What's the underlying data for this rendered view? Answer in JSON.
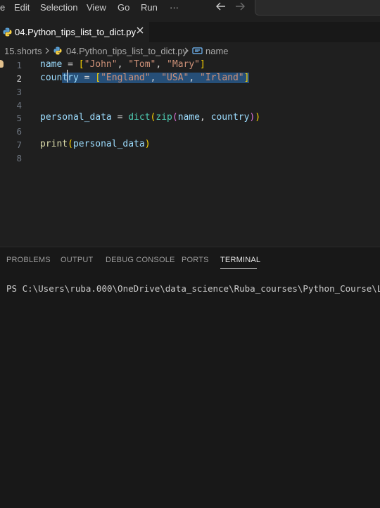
{
  "menu": {
    "partial_first": "e",
    "items": [
      "Edit",
      "Selection",
      "View",
      "Go",
      "Run"
    ],
    "more": "···"
  },
  "nav": {
    "back_icon": "arrow-left-icon",
    "forward_icon": "arrow-right-icon"
  },
  "tab": {
    "label": "04.Python_tips_list_to_dict.py",
    "icon": "python-file-icon",
    "close_icon": "close-icon"
  },
  "breadcrumb": {
    "folder": "15.shorts",
    "file": "04.Python_tips_list_to_dict.py",
    "symbol": "name",
    "symbol_icon": "symbol-variable-icon",
    "separator_icon": "chevron-right-icon"
  },
  "editor": {
    "line_numbers": [
      "1",
      "2",
      "3",
      "4",
      "5",
      "6",
      "7",
      "8"
    ],
    "current_line": "2",
    "lightbulb_icon": "lightbulb-icon",
    "line1": {
      "var": "name",
      "eq": " = ",
      "open": "[",
      "s1": "\"John\"",
      "c1": ", ",
      "s2": "\"Tom\"",
      "c2": ", ",
      "s3": "\"Mary\"",
      "close": "]"
    },
    "line2": {
      "var_a": "coun",
      "var_b": "try",
      "sp": " ",
      "sel_text_pre": "= ",
      "open": "[",
      "s1": "\"England\"",
      "c1": ", ",
      "s2": "\"USA\"",
      "c2": ", ",
      "s3": "\"Irland\"",
      "close": "]"
    },
    "line5": {
      "var": "personal_data",
      "eq": " = ",
      "fn1": "dict",
      "p1": "(",
      "fn2": "zip",
      "p2": "(",
      "a1": "name",
      "comma": ", ",
      "a2": "country",
      "p3": ")",
      "p4": ")"
    },
    "line7": {
      "fn": "print",
      "p1": "(",
      "arg": "personal_data",
      "p2": ")"
    }
  },
  "panel": {
    "tabs": [
      "PROBLEMS",
      "OUTPUT",
      "DEBUG CONSOLE",
      "PORTS",
      "TERMINAL"
    ],
    "active_tab": "TERMINAL",
    "terminal_line": "PS C:\\Users\\ruba.000\\OneDrive\\data_science\\Ruba_courses\\Python_Course\\Le"
  },
  "colors": {
    "background": "#1f1f1f",
    "selection": "#264f78",
    "string": "#ce9178",
    "variable": "#9cdcfe",
    "function": "#dcdcaa",
    "bracket1": "#ffd700",
    "bracket2": "#da70d6"
  }
}
